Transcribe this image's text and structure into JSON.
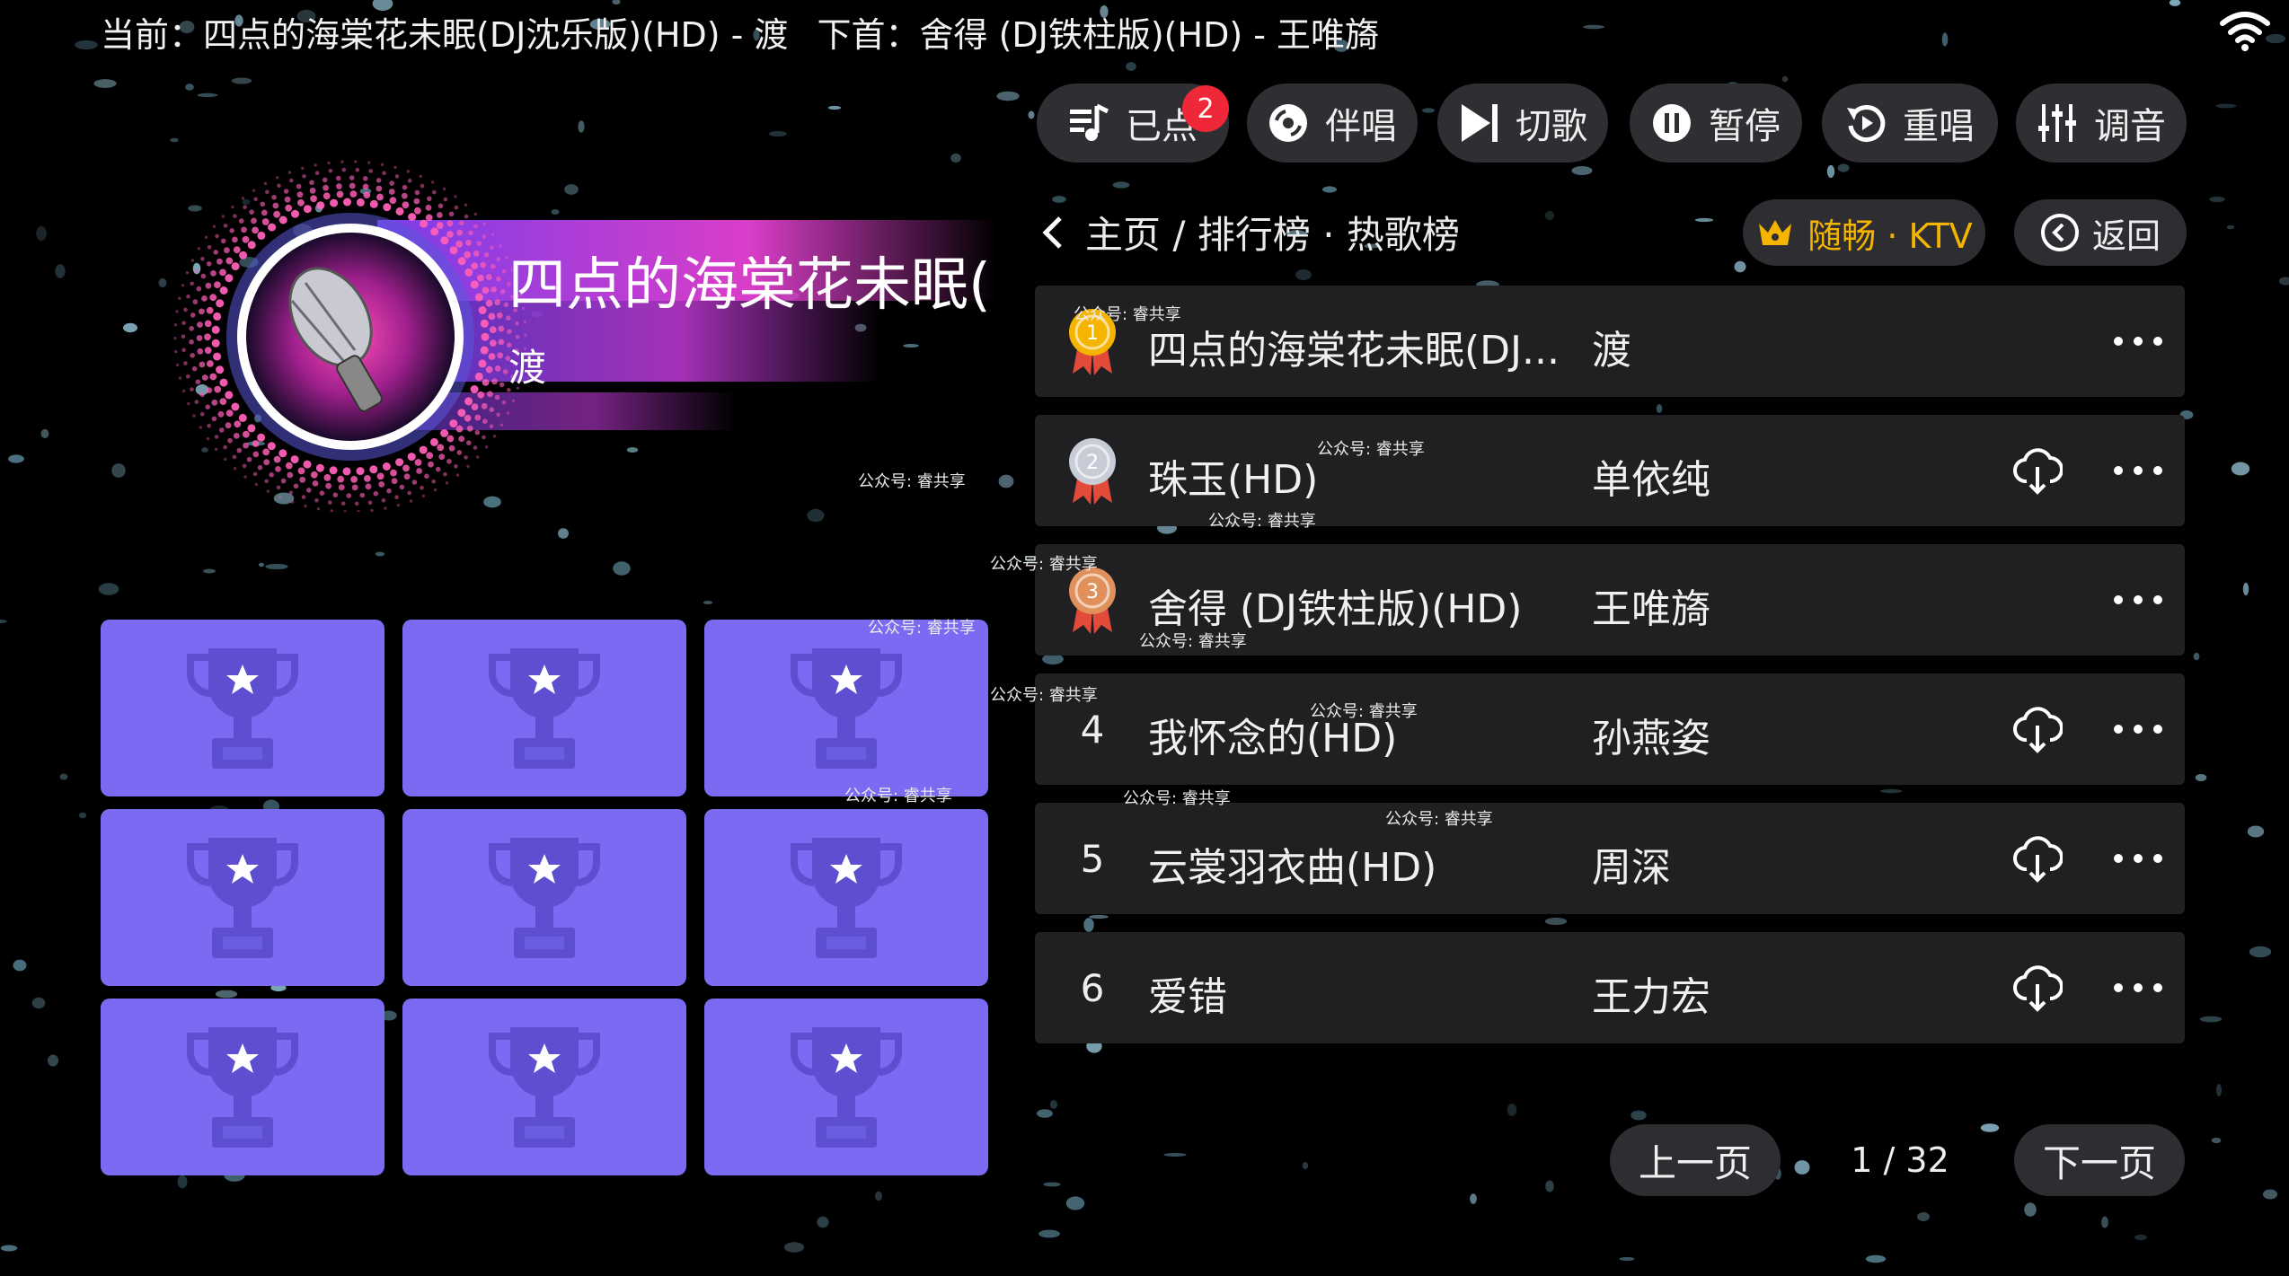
{
  "topbar": {
    "current": "当前：四点的海棠花未眠(DJ沈乐版)(HD) - 渡",
    "next": "下首：舍得 (DJ铁柱版)(HD) - 王唯旖"
  },
  "toolbar": {
    "queue_label": "已点",
    "queue_count": "2",
    "accompany_label": "伴唱",
    "skip_label": "切歌",
    "pause_label": "暂停",
    "replay_label": "重唱",
    "tune_label": "调音"
  },
  "breadcrumb": "主页 / 排行榜 · 热歌榜",
  "brand_label": "随畅 · KTV",
  "back_label": "返回",
  "now_playing": {
    "title": "四点的海棠花未眠(",
    "artist": "渡"
  },
  "songs": [
    {
      "rank": "1",
      "title": "四点的海棠花未眠(DJ...",
      "artist": "渡",
      "downloadable": false
    },
    {
      "rank": "2",
      "title": "珠玉(HD)",
      "artist": "单依纯",
      "downloadable": true
    },
    {
      "rank": "3",
      "title": "舍得 (DJ铁柱版)(HD)",
      "artist": "王唯旖",
      "downloadable": false
    },
    {
      "rank": "4",
      "title": "我怀念的(HD)",
      "artist": "孙燕姿",
      "downloadable": true
    },
    {
      "rank": "5",
      "title": "云裳羽衣曲(HD)",
      "artist": "周深",
      "downloadable": true
    },
    {
      "rank": "6",
      "title": "爱错",
      "artist": "王力宏",
      "downloadable": true
    }
  ],
  "pagination": {
    "prev_label": "上一页",
    "page": "1 / 32",
    "next_label": "下一页"
  },
  "watermark": "公众号: 睿共享",
  "colors": {
    "tile": "#7a6bf2",
    "trophy": "#5d4fd0",
    "badge": "#ee2838",
    "gold": "#f5b400",
    "accent_pink": "#e83cc8"
  },
  "icons": {
    "queue": "playlist-icon",
    "accompany": "disc-icon",
    "skip": "skip-next-icon",
    "pause": "pause-icon",
    "replay": "replay-icon",
    "tune": "equalizer-icon",
    "brand": "crown-icon",
    "back": "back-circle-icon",
    "download": "cloud-download-icon",
    "more": "more-dots-icon",
    "tile": "trophy-icon"
  }
}
